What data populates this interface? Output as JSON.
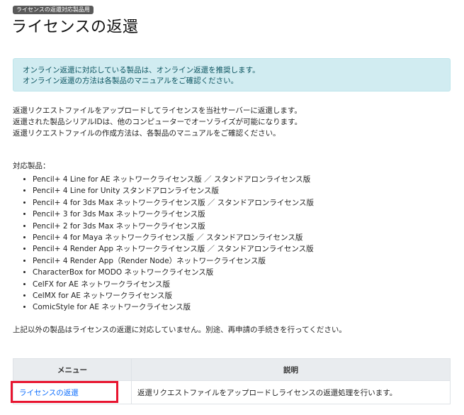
{
  "header": {
    "badge": "ライセンスの返還対応製品用",
    "title": "ライセンスの返還"
  },
  "alert": {
    "lines": [
      "オンライン返還に対応している製品は、オンライン返還を推奨します。",
      "オンライン返還の方法は各製品のマニュアルをご確認ください。"
    ]
  },
  "intro": {
    "lines": [
      "返還リクエストファイルをアップロードしてライセンスを当社サーバーに返還します。",
      "返還された製品シリアルIDは、他のコンピューターでオーソライズが可能になります。",
      "返還リクエストファイルの作成方法は、各製品のマニュアルをご確認ください。"
    ]
  },
  "products": {
    "label": "対応製品：",
    "items": [
      "Pencil+ 4 Line for AE ネットワークライセンス版 ／ スタンドアロンライセンス版",
      "Pencil+ 4 Line for Unity スタンドアロンライセンス版",
      "Pencil+ 4 for 3ds Max ネットワークライセンス版 ／ スタンドアロンライセンス版",
      "Pencil+ 3 for 3ds Max ネットワークライセンス版",
      "Pencil+ 2 for 3ds Max ネットワークライセンス版",
      "Pencil+ 4 for Maya ネットワークライセンス版 ／ スタンドアロンライセンス版",
      "Pencil+ 4 Render App ネットワークライセンス版 ／ スタンドアロンライセンス版",
      "Pencil+ 4 Render App（Render Node）ネットワークライセンス版",
      "CharacterBox for MODO ネットワークライセンス版",
      "CelFX for AE ネットワークライセンス版",
      "CelMX for AE ネットワークライセンス版",
      "ComicStyle for AE ネットワークライセンス版"
    ]
  },
  "note": "上記以外の製品はライセンスの返還に対応していません。別途、再申請の手続きを行ってください。",
  "table": {
    "headers": {
      "menu": "メニュー",
      "description": "説明"
    },
    "rows": [
      {
        "menu": "ライセンスの返還",
        "description": "返還リクエストファイルをアップロードしライセンスの返還処理を行います。"
      }
    ]
  },
  "colors": {
    "alert_bg": "#d1ecf1",
    "alert_text": "#0c5460",
    "link": "#0d6efd",
    "highlight": "#e8142f"
  }
}
